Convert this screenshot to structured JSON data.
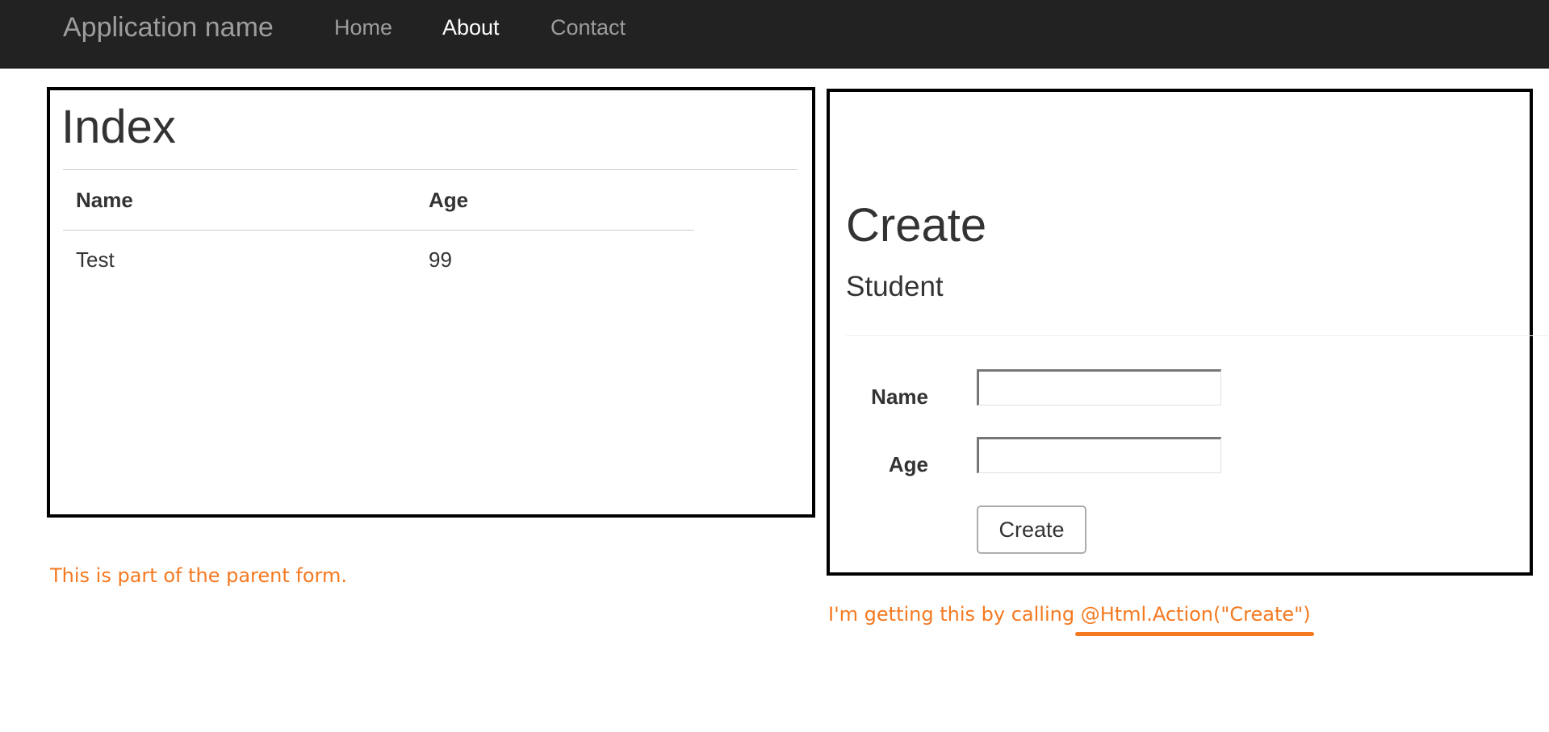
{
  "navbar": {
    "brand": "Application name",
    "links": [
      {
        "label": "Home",
        "active": false
      },
      {
        "label": "About",
        "active": true
      },
      {
        "label": "Contact",
        "active": false
      }
    ],
    "background": "#222222"
  },
  "index": {
    "title": "Index",
    "columns": [
      "Name",
      "Age"
    ],
    "rows": [
      [
        "Test",
        "99"
      ]
    ]
  },
  "create": {
    "title": "Create",
    "subtitle": "Student",
    "fields": [
      {
        "label": "Name",
        "value": "",
        "placeholder": ""
      },
      {
        "label": "Age",
        "value": "",
        "placeholder": ""
      }
    ],
    "submit_label": "Create"
  },
  "annotations": {
    "parent_note": "This is part of the parent form.",
    "action_note": "I'm getting this by calling @Html.Action(\"Create\")",
    "color": "#f47920"
  }
}
